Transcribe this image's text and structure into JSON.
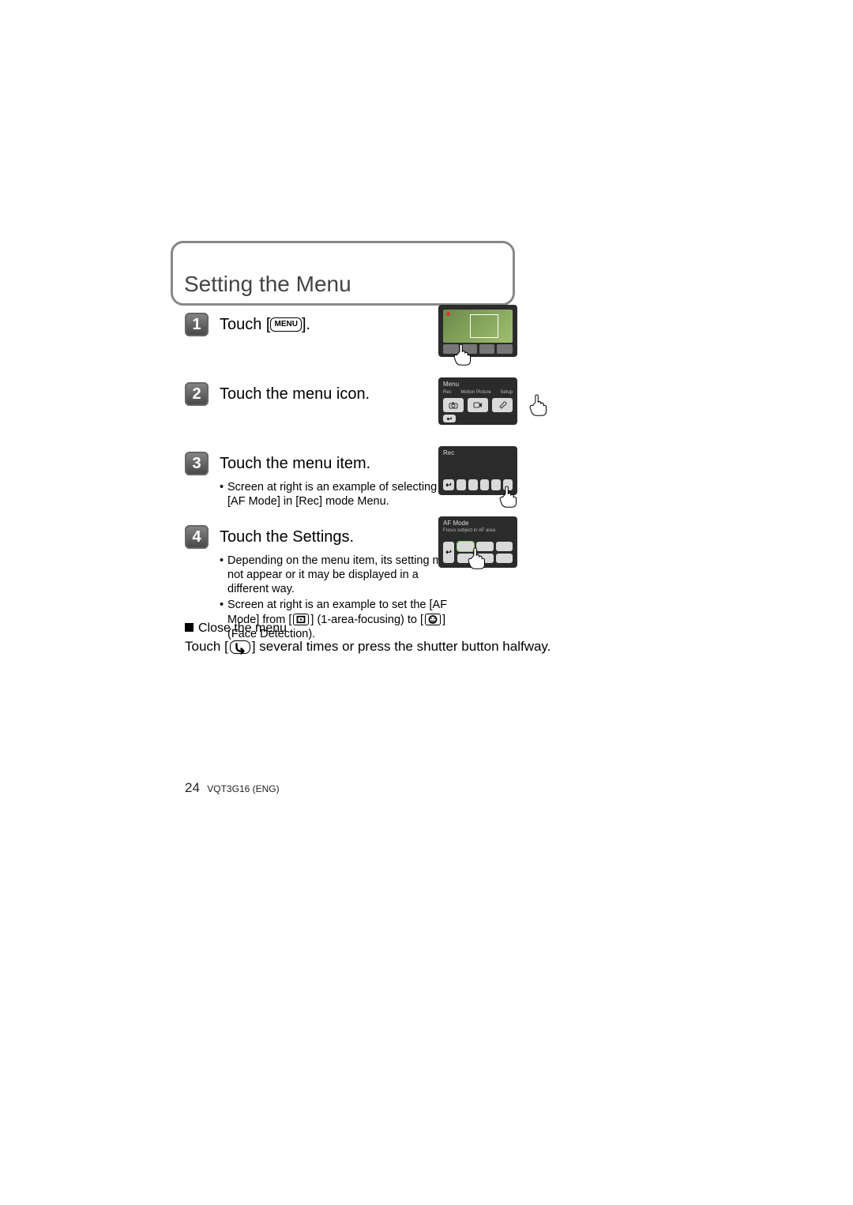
{
  "title": "Setting the Menu",
  "steps": {
    "s1": {
      "num": "1",
      "title_pre": "Touch [",
      "menu_label": "MENU",
      "title_post": "]."
    },
    "s2": {
      "num": "2",
      "title": "Touch the menu icon."
    },
    "s3": {
      "num": "3",
      "title": "Touch the menu item.",
      "bullet": "Screen at right is an example of selecting [AF Mode] in [Rec] mode Menu."
    },
    "s4": {
      "num": "4",
      "title": "Touch the Settings.",
      "bullet1": "Depending on the menu item, its setting may not appear or it may be displayed in a different way.",
      "bullet2_pre": "Screen at right is an example to set the [AF Mode] from [",
      "bullet2_mid": "] (1-area-focusing) to [",
      "bullet2_post": "] (Face Detection)."
    }
  },
  "close": {
    "heading": "Close the menu",
    "body_pre": "Touch [",
    "body_post": "] several times or press the shutter button halfway."
  },
  "screens": {
    "shot2": {
      "menu_label": "Menu",
      "tab_rec": "Rec",
      "tab_motion": "Motion Picture",
      "tab_setup": "Setup"
    },
    "shot3": {
      "header": "Rec"
    },
    "shot4": {
      "header": "AF Mode",
      "sub": "Focus subject in AF area"
    }
  },
  "footer": {
    "page": "24",
    "code": "VQT3G16 (ENG)"
  },
  "icons": {
    "back_arrow": "↩",
    "area_focus": "▣",
    "face_detect": "☺",
    "camera": "📷",
    "video": "🎞",
    "wrench": "🔧"
  }
}
